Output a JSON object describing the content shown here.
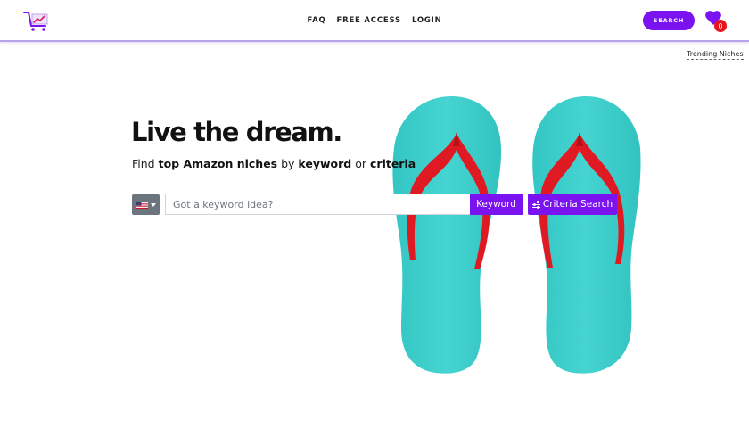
{
  "header": {
    "nav": [
      {
        "label": "FAQ"
      },
      {
        "label": "FREE ACCESS"
      },
      {
        "label": "LOGIN"
      }
    ],
    "search_button": "SEARCH",
    "favorites_count": "0"
  },
  "trending_link": "Trending Niches",
  "hero": {
    "title": "Live the dream.",
    "sub_prefix": "Find ",
    "sub_bold1": "top Amazon niches",
    "sub_mid1": " by ",
    "sub_bold2": "keyword",
    "sub_mid2": " or ",
    "sub_bold3": "criteria"
  },
  "search": {
    "placeholder": "Got a keyword idea?",
    "value": "",
    "keyword_button": "Keyword",
    "criteria_button": "Criteria Search"
  },
  "colors": {
    "accent": "#7b12f0",
    "badge": "#e8141c",
    "flop_sole": "#3fcfcc",
    "flop_strap": "#e01a22"
  },
  "icons": {
    "logo": "cart-chart-logo-icon",
    "favorites": "heart-icon",
    "country": "us-flag-icon",
    "criteria": "sliders-icon"
  }
}
